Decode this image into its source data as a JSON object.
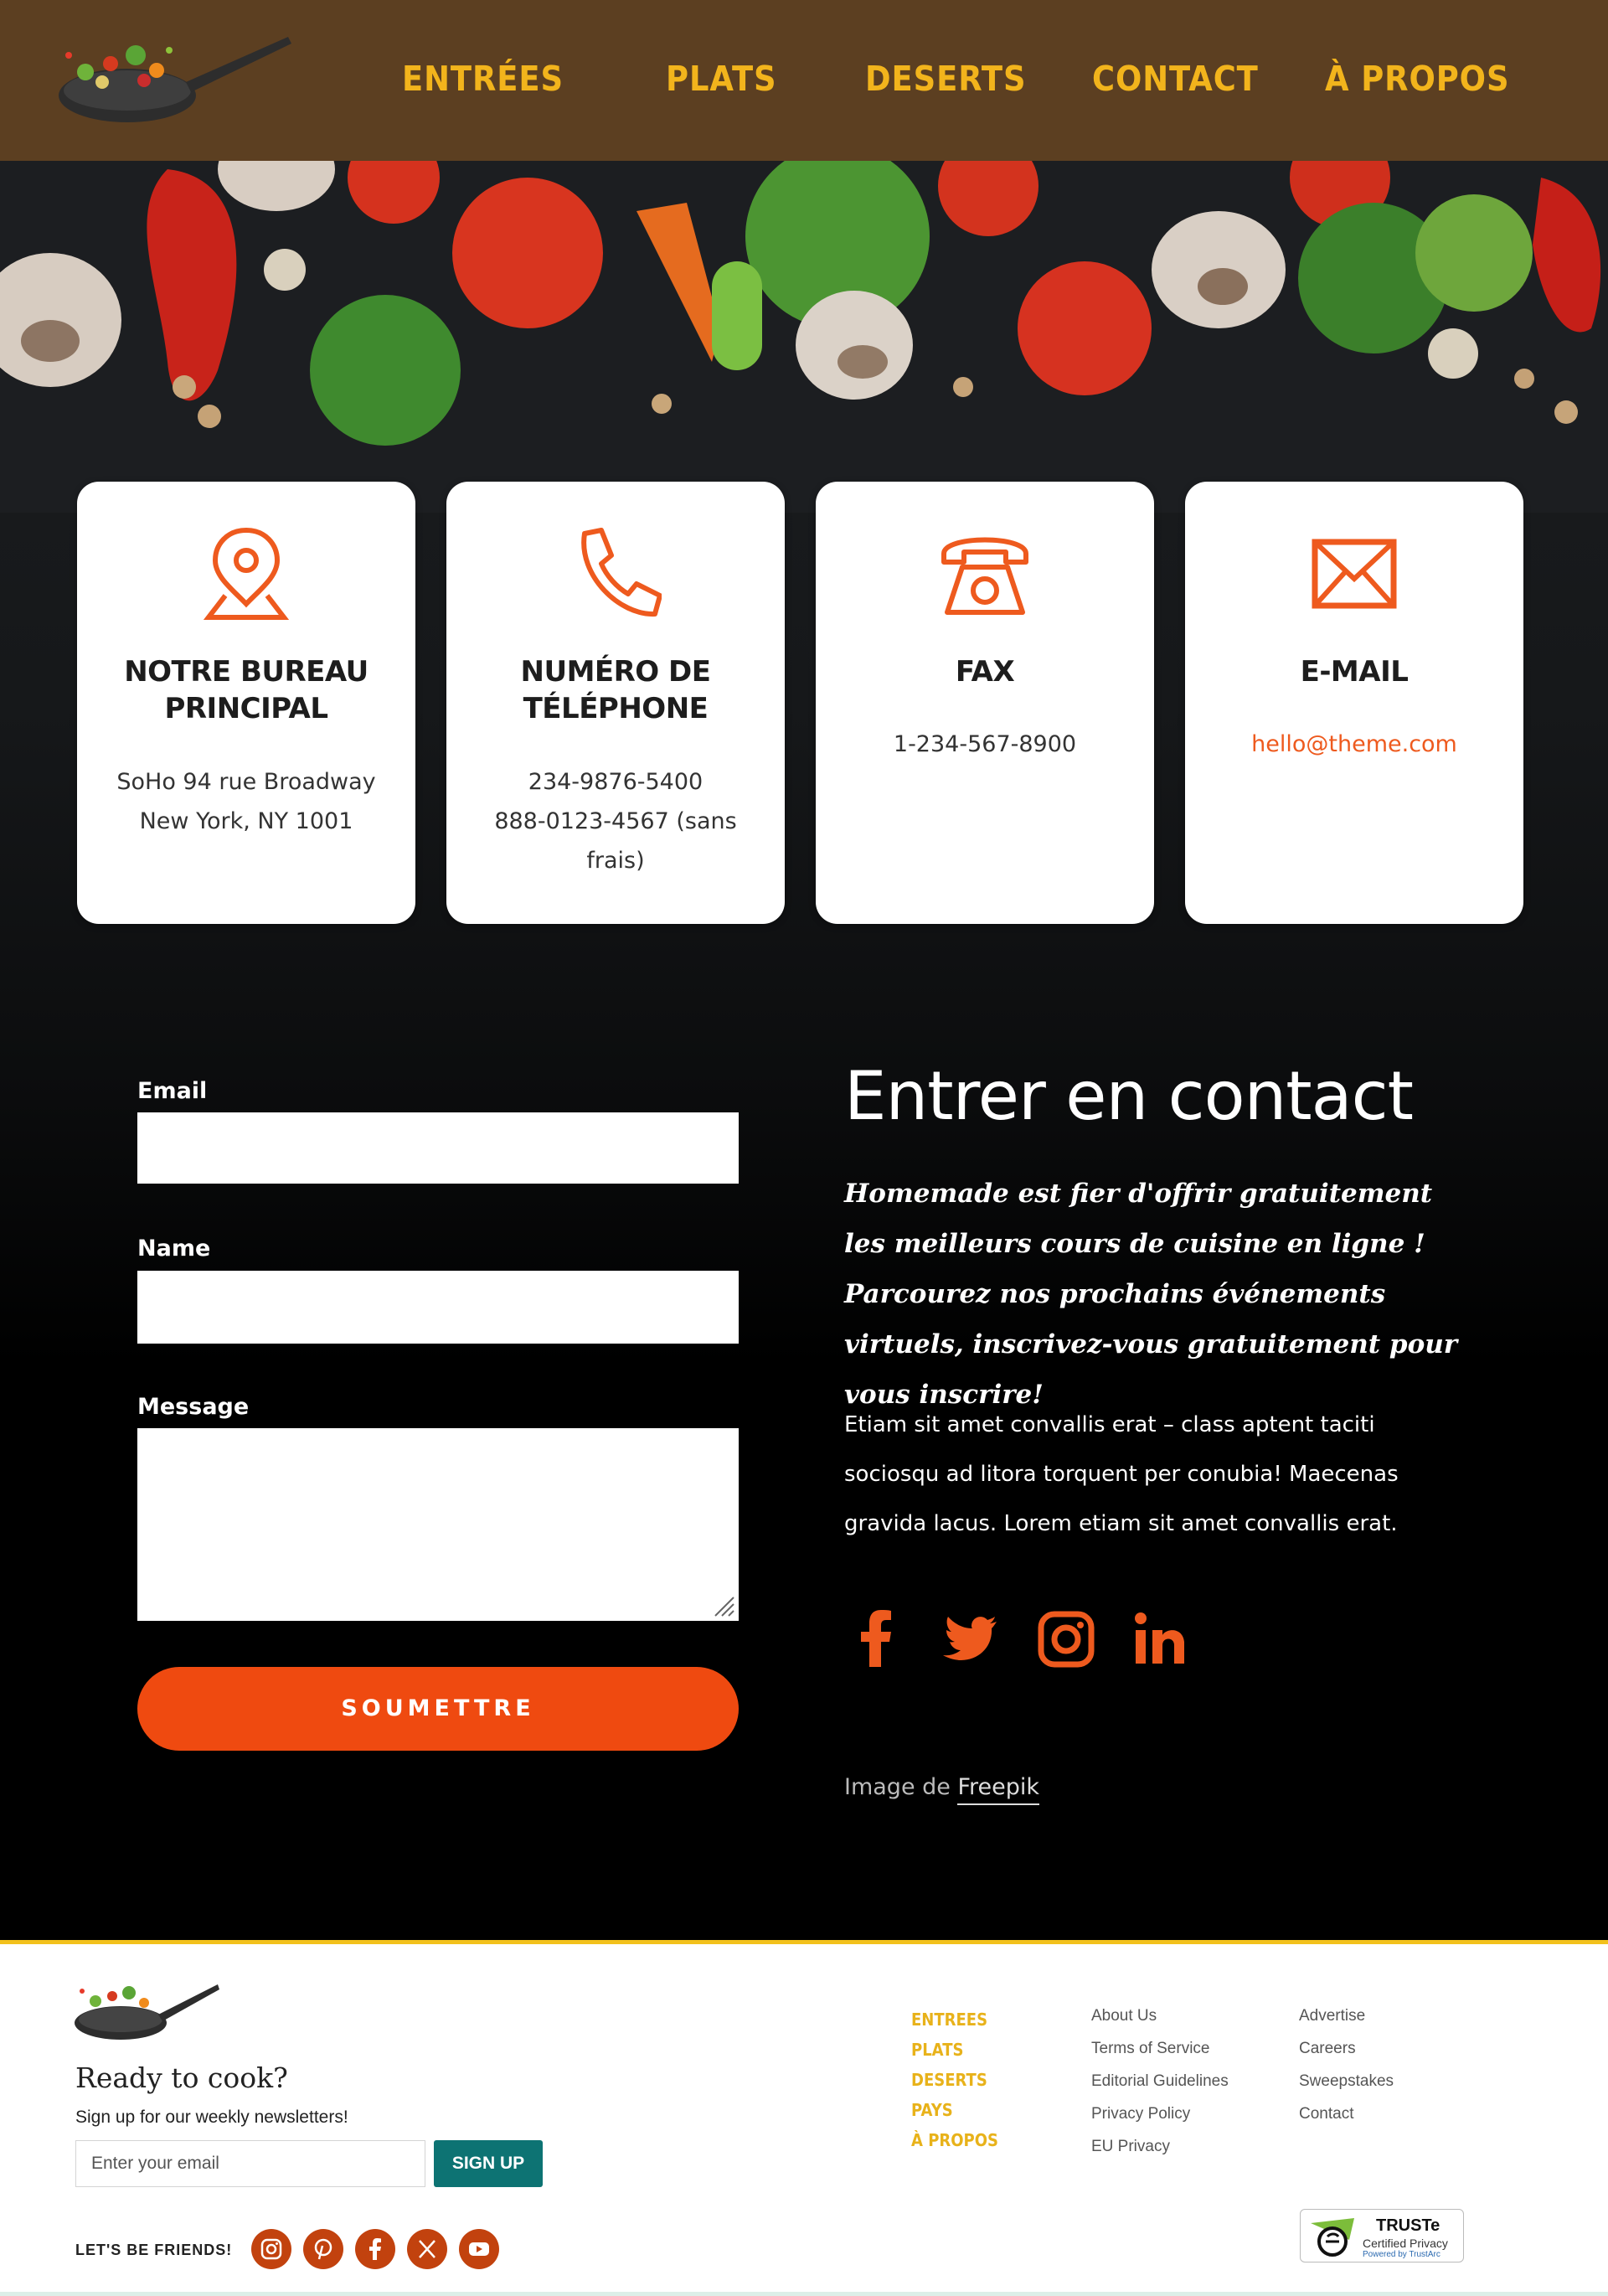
{
  "header": {
    "nav": [
      "ENTRÉES",
      "PLATS",
      "DESERTS",
      "CONTACT",
      "À PROPOS"
    ]
  },
  "cards": [
    {
      "title": "NOTRE BUREAU PRINCIPAL",
      "lines": [
        "SoHo 94 rue Broadway",
        "New York, NY 1001"
      ],
      "icon": "location-pin-icon"
    },
    {
      "title": "NUMÉRO DE TÉLÉPHONE",
      "lines": [
        "234-9876-5400",
        "888-0123-4567 (sans frais)"
      ],
      "icon": "phone-icon"
    },
    {
      "title": "FAX",
      "lines": [
        "1-234-567-8900"
      ],
      "icon": "telephone-fax-icon"
    },
    {
      "title": "E-MAIL",
      "lines": [
        "hello@theme.com"
      ],
      "icon": "envelope-icon"
    }
  ],
  "form": {
    "email_label": "Email",
    "name_label": "Name",
    "message_label": "Message",
    "submit_label": "SOUMETTRE"
  },
  "contact": {
    "title": "Entrer en contact",
    "lead": "Homemade est fier d'offrir gratuitement les meilleurs cours de cuisine en ligne ! Parcourez nos prochains événements virtuels, inscrivez-vous gratuitement pour vous inscrire!",
    "body": "Etiam sit amet convallis erat – class aptent taciti sociosqu ad litora torquent per conubia! Maecenas gravida lacus. Lorem etiam sit amet convallis erat.",
    "social_icons": [
      "facebook-icon",
      "twitter-icon",
      "instagram-icon",
      "linkedin-icon"
    ],
    "credit_prefix": "Image de ",
    "credit_link": "Freepik"
  },
  "footer": {
    "ready": "Ready to cook?",
    "weekly": "Sign up for our weekly newsletters!",
    "email_placeholder": "Enter your email",
    "signup": "SIGN UP",
    "friends": "LET'S BE FRIENDS!",
    "social_icons": [
      "instagram-icon",
      "pinterest-icon",
      "facebook-icon",
      "x-icon",
      "youtube-icon"
    ],
    "nav": [
      "ENTREES",
      "PLATS",
      "DESERTS",
      "PAYS",
      "À PROPOS"
    ],
    "links_col1": [
      "About Us",
      "Terms of Service",
      "Editorial Guidelines",
      "Privacy Policy",
      "EU Privacy"
    ],
    "links_col2": [
      "Advertise",
      "Careers",
      "Sweepstakes",
      "Contact"
    ],
    "truste_title": "TRUSTe",
    "truste_sub": "Certified Privacy",
    "truste_powered": "Powered by TrustArc"
  },
  "colors": {
    "header_bg": "#5c3f21",
    "nav_gold": "#f2b41c",
    "accent_orange": "#ef4a10",
    "teal": "#0d7373"
  }
}
